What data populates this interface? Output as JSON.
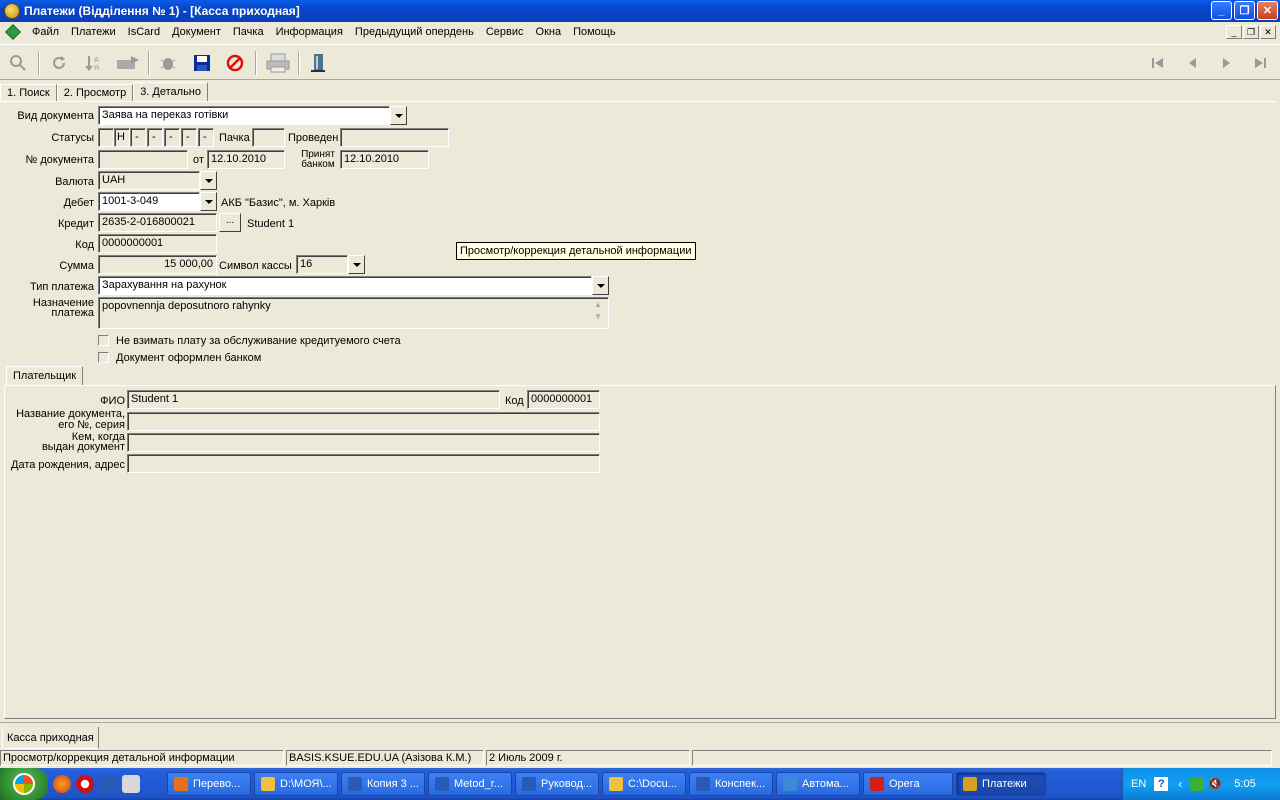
{
  "window": {
    "title": "Платежи (Відділення № 1) - [Касса приходная]",
    "controls": [
      "_",
      "❐",
      "✕"
    ]
  },
  "menu": {
    "items": [
      "Файл",
      "Платежи",
      "IsCard",
      "Документ",
      "Пачка",
      "Информация",
      "Предыдущий опердень",
      "Сервис",
      "Окна",
      "Помощь"
    ],
    "mdi_controls": [
      "_",
      "❐",
      "✕"
    ]
  },
  "toolbar": {
    "icons": [
      "search-icon",
      "refresh-icon",
      "sort-icon",
      "filter-icon",
      "bug-icon",
      "save-icon",
      "cancel-icon",
      "print-icon",
      "door-icon"
    ],
    "nav_icons": [
      "first-icon",
      "prev-icon",
      "next-icon",
      "last-icon"
    ]
  },
  "tabs": [
    "1. Поиск",
    "2. Просмотр",
    "3. Детально"
  ],
  "form": {
    "doc_type_label": "Вид документа",
    "doc_type_value": "Заява на переказ готівки",
    "statuses_label": "Статусы",
    "statuses": [
      "",
      "Н",
      "-",
      "-",
      "-",
      "-",
      "-"
    ],
    "batch_label": "Пачка",
    "batch_value": "",
    "posted_label": "Проведен",
    "posted_value": "",
    "doc_num_label": "№ документа",
    "doc_num_value": "",
    "from_label": "от",
    "from_value": "12.10.2010",
    "accepted_label_1": "Принят",
    "accepted_label_2": "банком",
    "accepted_value": "12.10.2010",
    "currency_label": "Валюта",
    "currency_value": "UAH",
    "debit_label": "Дебет",
    "debit_value": "1001-3-049",
    "debit_bank": "АКБ \"Базис\", м. Харків",
    "credit_label": "Кредит",
    "credit_value": "2635-2-016800021",
    "credit_btn": "...",
    "credit_name": "Student 1",
    "code_label": "Код",
    "code_value": "0000000001",
    "sum_label": "Сумма",
    "sum_value": "15 000,00",
    "cash_symbol_label": "Символ кассы",
    "cash_symbol_value": "16",
    "payment_type_label": "Тип платежа",
    "payment_type_value": "Зарахування на рахунок",
    "purpose_label_1": "Назначение",
    "purpose_label_2": "платежа",
    "purpose_value": "popovnennja deposutnoro rahynky",
    "check1_label": "Не взимать плату за обслуживание кредитуемого счета",
    "check2_label": "Документ оформлен банком",
    "tooltip": "Просмотр/коррекция детальной информации"
  },
  "payer": {
    "tab_label": "Плательщик",
    "fio_label": "ФИО",
    "fio_value": "Student 1",
    "code_label": "Код",
    "code_value": "0000000001",
    "doc_label_1": "Название документа,",
    "doc_label_2": "его №, серия",
    "issued_label_1": "Кем, когда",
    "issued_label_2": "выдан документ",
    "birth_label": "Дата рождения, адрес"
  },
  "bottom": {
    "doc_tab": "Касса приходная",
    "status": [
      "Просмотр/коррекция детальной информации",
      "BASIS.KSUE.EDU.UA (Азізова К.М.)",
      "2 Июль 2009 г.",
      ""
    ]
  },
  "taskbar": {
    "items": [
      {
        "label": "Перево...",
        "color": "#e8701a"
      },
      {
        "label": "D:\\МОЯ\\...",
        "color": "#f0c040"
      },
      {
        "label": "Копия 3 ...",
        "color": "#2a5ab8"
      },
      {
        "label": "Metod_r...",
        "color": "#2a5ab8"
      },
      {
        "label": "Руковод...",
        "color": "#2a5ab8"
      },
      {
        "label": "C:\\Docu...",
        "color": "#f0c040"
      },
      {
        "label": "Конспек...",
        "color": "#2a5ab8"
      },
      {
        "label": "Автома...",
        "color": "#3a8ad8"
      },
      {
        "label": "Opera",
        "color": "#d0201a"
      },
      {
        "label": "Платежи",
        "color": "#d8a020"
      }
    ],
    "lang": "EN",
    "time": "5:05"
  }
}
